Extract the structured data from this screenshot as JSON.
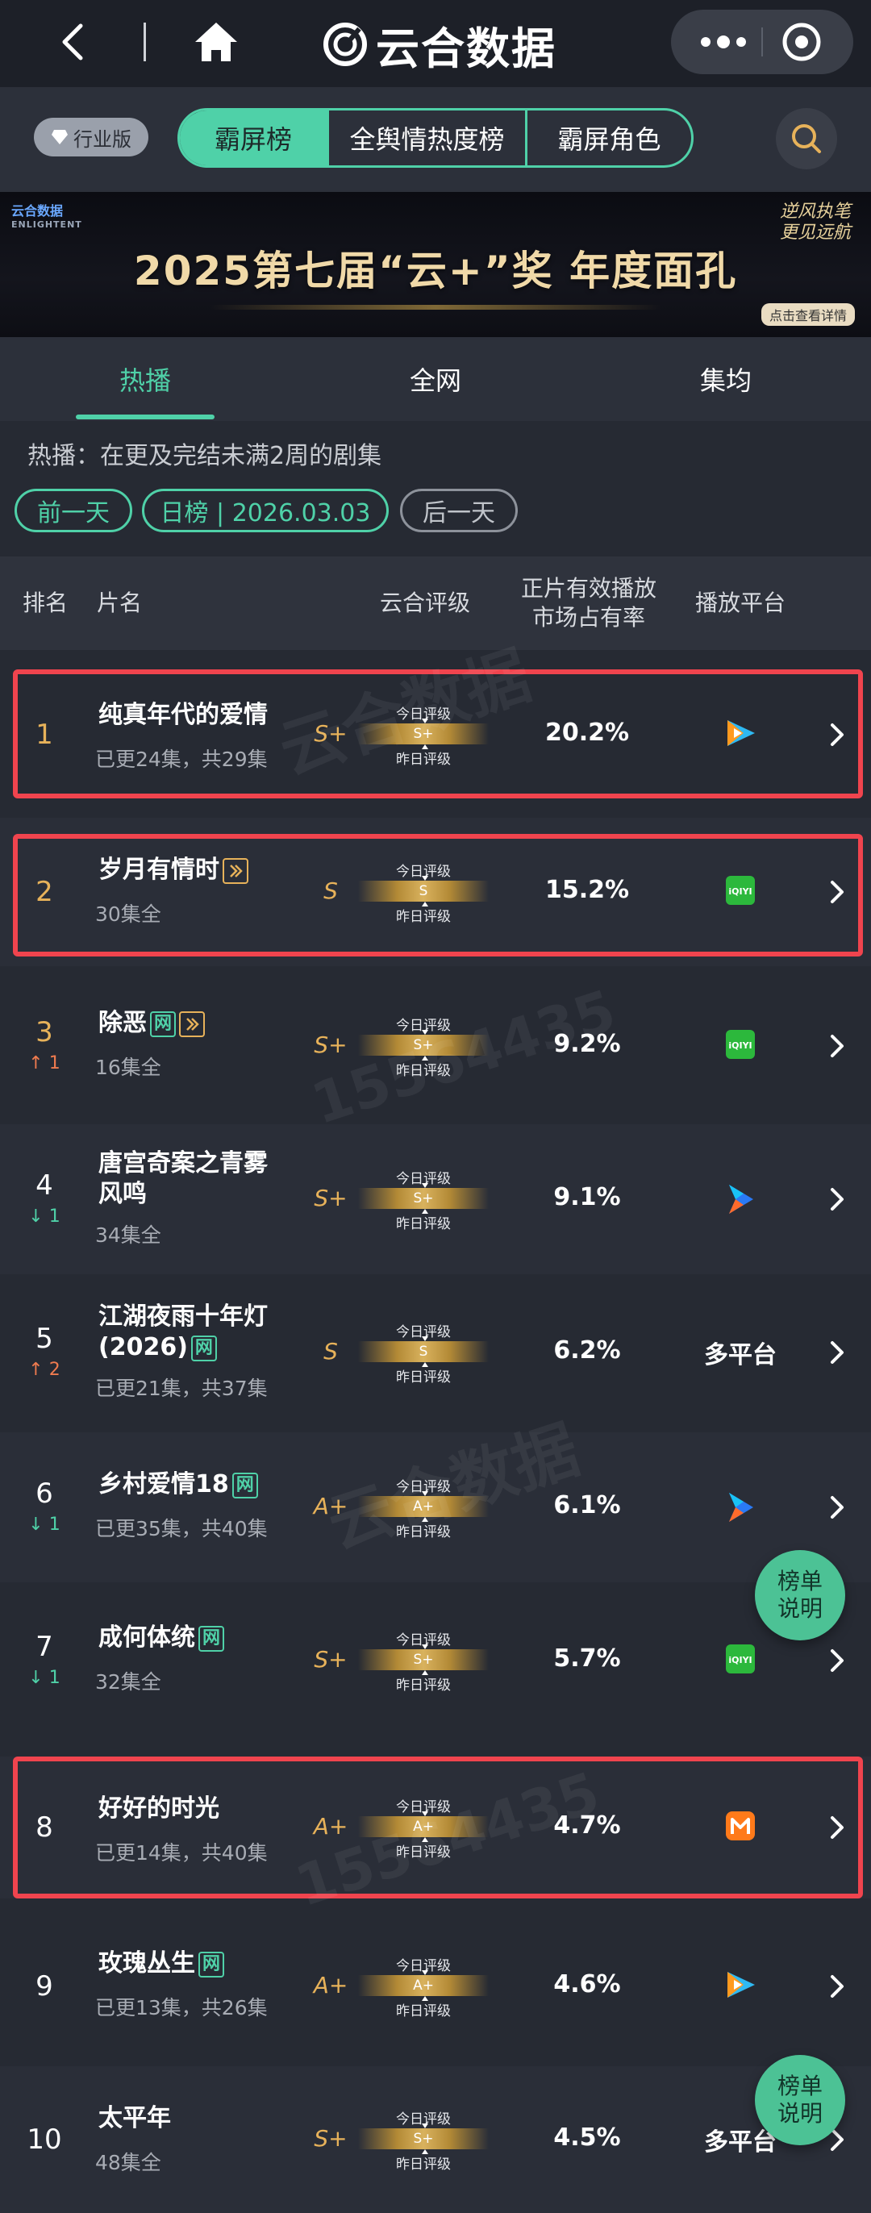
{
  "nav": {
    "brand": "云合数据"
  },
  "toolbar": {
    "industry_label": "行业版",
    "segments": [
      "霸屏榜",
      "全舆情热度榜",
      "霸屏角色"
    ]
  },
  "banner": {
    "logo": "云合数据",
    "logo_sub": "ENLIGHTENT",
    "title": "2025第七届“云+”奖  年度面孔",
    "slogan": "逆风执笔 更见远航",
    "cta": "点击查看详情"
  },
  "tabs": [
    "热播",
    "全网",
    "集均"
  ],
  "info": {
    "description": "热播：在更及完结未满2周的剧集",
    "prev_day": "前一天",
    "date": "日榜 | 2026.03.03",
    "next_day": "后一天"
  },
  "table_header": {
    "rank": "排名",
    "title": "片名",
    "rating": "云合评级",
    "share_line1": "正片有效播放",
    "share_line2": "市场占有率",
    "platform": "播放平台"
  },
  "rating_labels": {
    "today": "今日评级",
    "yesterday": "昨日评级"
  },
  "rows": [
    {
      "rank": "1",
      "change": "",
      "title": "纯真年代的爱情",
      "episodes": "已更24集，共29集",
      "grade": "S+",
      "share": "20.2%",
      "platform": "tencent-video-icon"
    },
    {
      "rank": "2",
      "change": "",
      "title": "岁月有情时",
      "episodes": "30集全",
      "grade": "S",
      "share": "15.2%",
      "platform": "iqiyi-icon"
    },
    {
      "rank": "3",
      "change": "1",
      "title": "除恶",
      "episodes": "16集全",
      "grade": "S+",
      "share": "9.2%",
      "platform": "iqiyi-icon"
    },
    {
      "rank": "4",
      "change": "1",
      "title": "唐宫奇案之青雾风鸣",
      "episodes": "34集全",
      "grade": "S+",
      "share": "9.1%",
      "platform": "youku-icon"
    },
    {
      "rank": "5",
      "change": "2",
      "title": "江湖夜雨十年灯(2026)",
      "episodes": "已更21集，共37集",
      "grade": "S",
      "share": "6.2%",
      "platform": "多平台"
    },
    {
      "rank": "6",
      "change": "1",
      "title": "乡村爱情18",
      "episodes": "已更35集，共40集",
      "grade": "A+",
      "share": "6.1%",
      "platform": "youku-icon"
    },
    {
      "rank": "7",
      "change": "1",
      "title": "成何体统",
      "episodes": "32集全",
      "grade": "S+",
      "share": "5.7%",
      "platform": "iqiyi-icon"
    },
    {
      "rank": "8",
      "change": "",
      "title": "好好的时光",
      "episodes": "已更14集，共40集",
      "grade": "A+",
      "share": "4.7%",
      "platform": "mango-tv-icon"
    },
    {
      "rank": "9",
      "change": "",
      "title": "玫瑰丛生",
      "episodes": "已更13集，共26集",
      "grade": "A+",
      "share": "4.6%",
      "platform": "tencent-video-icon"
    },
    {
      "rank": "10",
      "change": "",
      "title": "太平年",
      "episodes": "48集全",
      "grade": "S+",
      "share": "4.5%",
      "platform": "多平台"
    }
  ],
  "tags": {
    "net": "网"
  },
  "platform_text": {
    "iqiyi": "iQIYI"
  },
  "float_button": {
    "line1": "榜单",
    "line2": "说明"
  },
  "watermark": {
    "id": "15564435",
    "brand": "云合数据",
    "brand_en": "ENLIGHTENT"
  },
  "colors": {
    "accent": "#4fd1a8",
    "gold": "#e7b25a",
    "highlight": "#f0444e",
    "up": "#ef7b4f",
    "down": "#4fd1a8"
  }
}
